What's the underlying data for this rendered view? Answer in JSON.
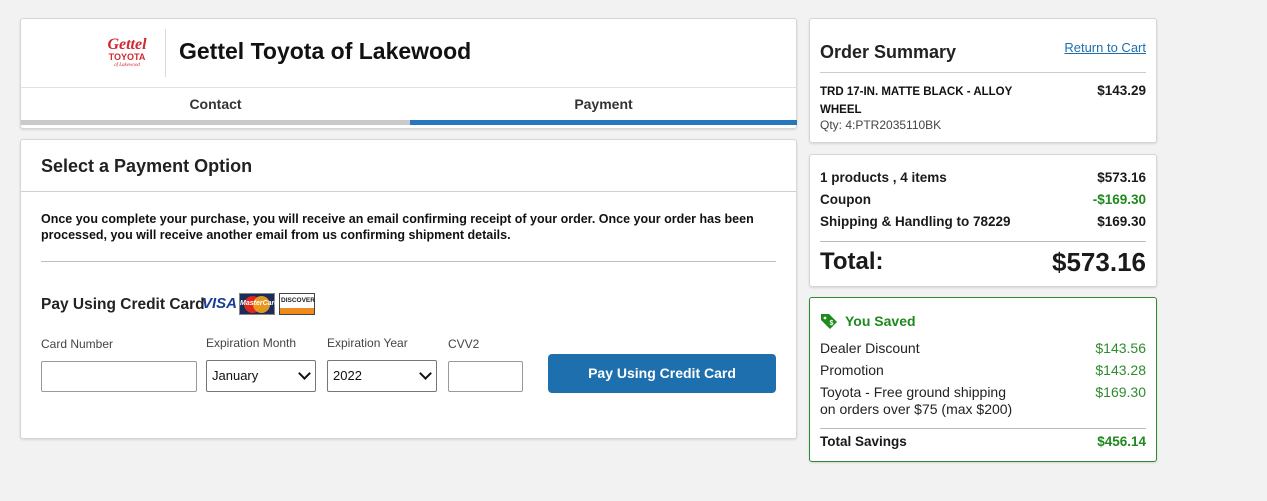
{
  "header": {
    "logo_text": {
      "line1": "Gettel",
      "line2": "TOYOTA",
      "line3": "of Lakewood"
    },
    "dealer_name": "Gettel Toyota of Lakewood",
    "tabs": [
      {
        "label": "Contact",
        "state": "complete"
      },
      {
        "label": "Payment",
        "state": "active"
      }
    ]
  },
  "payment": {
    "title": "Select a Payment Option",
    "description": "Once you complete your purchase, you will receive an email confirming receipt of your order. Once your order has been processed, you will receive another email from us confirming shipment details.",
    "cc_heading": "Pay Using Credit Card",
    "card_logos": {
      "visa": "VISA",
      "mastercard": "MasterCard",
      "discover": "DISCOVER"
    },
    "fields": {
      "card_number": {
        "label": "Card Number",
        "value": ""
      },
      "exp_month": {
        "label": "Expiration Month",
        "value": "January"
      },
      "exp_year": {
        "label": "Expiration Year",
        "value": "2022"
      },
      "cvv": {
        "label": "CVV2",
        "value": ""
      }
    },
    "submit_label": "Pay Using Credit Card"
  },
  "summary": {
    "title": "Order Summary",
    "return_link": "Return to Cart",
    "item": {
      "name": "TRD 17-IN. MATTE BLACK - ALLOY WHEEL",
      "price": "$143.29",
      "qty_sku": "Qty: 4:PTR2035110BK"
    }
  },
  "totals": {
    "rows": [
      {
        "label": "1 products , 4 items",
        "value": "$573.16"
      },
      {
        "label": "Coupon",
        "value": "-$169.30"
      },
      {
        "label": "Shipping & Handling to 78229",
        "value": "$169.30"
      }
    ],
    "total_label": "Total:",
    "total_value": "$573.16"
  },
  "savings": {
    "title": "You Saved",
    "rows": [
      {
        "label": "Dealer Discount",
        "value": "$143.56"
      },
      {
        "label": "Promotion",
        "value": "$143.28"
      },
      {
        "label": "Toyota - Free ground shipping on orders over $75 (max $200)",
        "value": "$169.30"
      }
    ],
    "total_label": "Total Savings",
    "total_value": "$456.14"
  },
  "colors": {
    "accent": "#1e6fae",
    "savings_green": "#1e8a1e",
    "logo_red": "#d22630"
  }
}
